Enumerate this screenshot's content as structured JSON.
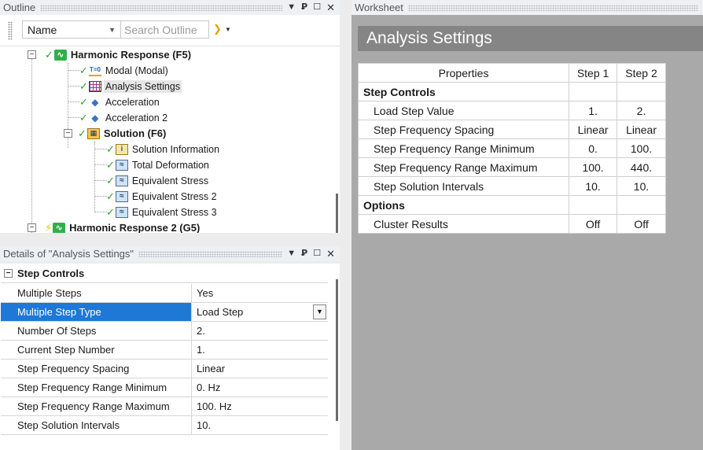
{
  "outline": {
    "title": "Outline",
    "combo_value": "Name",
    "search_placeholder": "Search Outline",
    "tree": [
      {
        "label": "Harmonic Response (F5)",
        "icon": "harmonic-icon"
      },
      {
        "label": "Modal (Modal)",
        "icon": "modal-icon"
      },
      {
        "label": "Analysis Settings",
        "icon": "analysis-settings-icon"
      },
      {
        "label": "Acceleration",
        "icon": "acceleration-icon"
      },
      {
        "label": "Acceleration 2",
        "icon": "acceleration-icon"
      },
      {
        "label": "Solution (F6)",
        "icon": "solution-icon"
      },
      {
        "label": "Solution Information",
        "icon": "solution-information-icon"
      },
      {
        "label": "Total Deformation",
        "icon": "result-icon"
      },
      {
        "label": "Equivalent Stress",
        "icon": "result-icon"
      },
      {
        "label": "Equivalent Stress 2",
        "icon": "result-icon"
      },
      {
        "label": "Equivalent Stress 3",
        "icon": "result-icon"
      },
      {
        "label": "Harmonic Response 2 (G5)",
        "icon": "harmonic-icon"
      }
    ]
  },
  "details": {
    "title": "Details of \"Analysis Settings\"",
    "section": "Step Controls",
    "rows": [
      {
        "key": "Multiple Steps",
        "value": "Yes"
      },
      {
        "key": "Multiple Step Type",
        "value": "Load Step"
      },
      {
        "key": "Number Of Steps",
        "value": "2."
      },
      {
        "key": "Current Step Number",
        "value": "1."
      },
      {
        "key": "Step Frequency Spacing",
        "value": "Linear"
      },
      {
        "key": "Step Frequency Range Minimum",
        "value": "0. Hz"
      },
      {
        "key": "Step Frequency Range Maximum",
        "value": "100. Hz"
      },
      {
        "key": "Step Solution Intervals",
        "value": "10."
      }
    ]
  },
  "worksheet": {
    "title": "Worksheet",
    "header": "Analysis Settings",
    "columns": [
      "Properties",
      "Step 1",
      "Step 2"
    ],
    "sections": [
      {
        "name": "Step Controls",
        "rows": [
          {
            "label": "Load Step Value",
            "step1": "1.",
            "step2": "2."
          },
          {
            "label": "Step Frequency Spacing",
            "step1": "Linear",
            "step2": "Linear"
          },
          {
            "label": "Step Frequency Range Minimum",
            "step1": "0.",
            "step2": "100."
          },
          {
            "label": "Step Frequency Range Maximum",
            "step1": "100.",
            "step2": "440."
          },
          {
            "label": "Step Solution Intervals",
            "step1": "10.",
            "step2": "10."
          }
        ]
      },
      {
        "name": "Options",
        "rows": [
          {
            "label": "Cluster Results",
            "step1": "Off",
            "step2": "Off"
          }
        ]
      }
    ]
  },
  "colors": {
    "selection": "#1e78d6",
    "worksheet_header": "#858585",
    "worksheet_bg": "#a9a9a9",
    "check": "#2aa02a"
  }
}
